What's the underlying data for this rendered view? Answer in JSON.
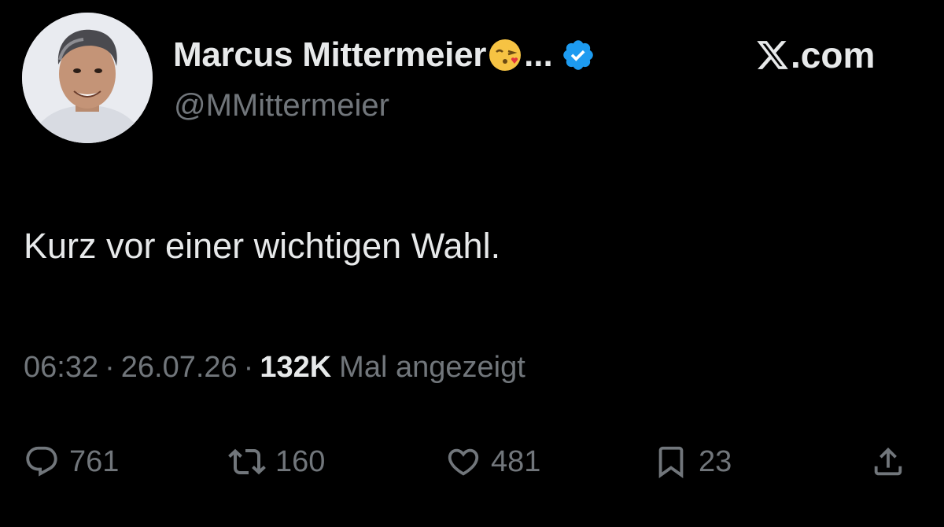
{
  "author": {
    "display_name": "Marcus Mittermeier",
    "name_emoji": "face-blowing-a-kiss",
    "ellipsis": "...",
    "verified": true,
    "handle": "@MMittermeier"
  },
  "site_brand": {
    "logo": "x-logo-icon",
    "suffix": ".com"
  },
  "tweet": {
    "text": "Kurz vor einer wichtigen Wahl."
  },
  "meta": {
    "time": "06:32",
    "separator": "·",
    "date": "26.07.26",
    "views_count": "132K",
    "views_label": "Mal angezeigt"
  },
  "actions": {
    "reply": {
      "icon": "reply-icon",
      "count": "761"
    },
    "retweet": {
      "icon": "retweet-icon",
      "count": "160"
    },
    "like": {
      "icon": "heart-icon",
      "count": "481"
    },
    "bookmark": {
      "icon": "bookmark-icon",
      "count": "23"
    },
    "share": {
      "icon": "share-icon"
    }
  },
  "colors": {
    "background": "#000000",
    "primary_text": "#e7e9ea",
    "secondary_text": "#71767b",
    "verified_badge": "#1d9bf0"
  }
}
